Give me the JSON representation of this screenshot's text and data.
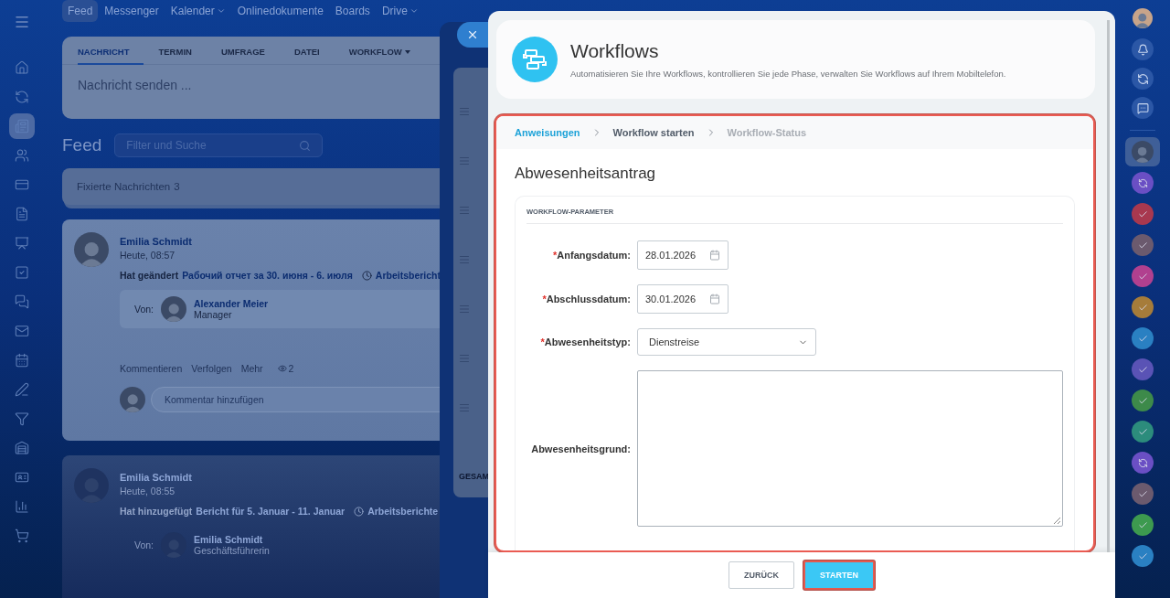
{
  "sidebar": {
    "items": [
      {
        "selected": false
      },
      {
        "selected": false
      },
      {
        "selected": true
      },
      {
        "selected": false
      },
      {
        "selected": false
      },
      {
        "selected": false
      },
      {
        "selected": false
      },
      {
        "selected": false
      },
      {
        "selected": false
      },
      {
        "selected": false
      },
      {
        "selected": false
      },
      {
        "selected": false
      },
      {
        "selected": false
      },
      {
        "selected": false
      },
      {
        "selected": false
      },
      {
        "selected": false
      },
      {
        "selected": false
      }
    ]
  },
  "top_nav": [
    {
      "label": "Feed",
      "selected": true,
      "has_menu": false
    },
    {
      "label": "Messenger",
      "selected": false,
      "has_menu": false
    },
    {
      "label": "Kalender",
      "selected": false,
      "has_menu": true
    },
    {
      "label": "Onlinedokumente",
      "selected": false,
      "has_menu": false
    },
    {
      "label": "Boards",
      "selected": false,
      "has_menu": false
    },
    {
      "label": "Drive",
      "selected": false,
      "has_menu": true
    }
  ],
  "composer": {
    "tabs": [
      {
        "label": "NACHRICHT",
        "selected": true,
        "has_menu": false
      },
      {
        "label": "TERMIN",
        "selected": false,
        "has_menu": false
      },
      {
        "label": "UMFRAGE",
        "selected": false,
        "has_menu": false
      },
      {
        "label": "DATEI",
        "selected": false,
        "has_menu": false
      },
      {
        "label": "WORKFLOW",
        "selected": false,
        "has_menu": true
      }
    ],
    "placeholder": "Nachricht senden ..."
  },
  "feed": {
    "title": "Feed",
    "search_placeholder": "Filter und Suche",
    "pinned": "Fixierte Nachrichten",
    "pinned_count": "3",
    "posts": [
      {
        "author": "Emilia Schmidt",
        "time": "Heute, 08:57",
        "action": "Hat geändert",
        "link": "Рабочий отчет за 30. июня - 6. июля",
        "category": "Arbeitsbericht",
        "from_label": "Von:",
        "from_name": "Alexander Meier",
        "from_role": "Manager",
        "actions": [
          "Kommentieren",
          "Verfolgen",
          "Mehr"
        ],
        "views": "2",
        "comment_placeholder": "Kommentar hinzufügen",
        "faded": false
      },
      {
        "author": "Emilia Schmidt",
        "time": "Heute, 08:55",
        "action": "Hat hinzugefügt",
        "link": "Bericht für 5. Januar - 11. Januar",
        "category": "Arbeitsberichte",
        "from_label": "Von:",
        "from_name": "Emilia Schmidt",
        "from_role": "Geschäftsführerin",
        "faded": true
      }
    ]
  },
  "back_panel": {
    "footer": "GESAM"
  },
  "panel": {
    "title": "Workflows",
    "subtitle": "Automatisieren Sie Ihre Workflows, kontrollieren Sie jede Phase, verwalten Sie Workflows auf Ihrem Mobiltelefon.",
    "steps": [
      {
        "label": "Anweisungen",
        "completed": true,
        "selected": false
      },
      {
        "label": "Workflow starten",
        "completed": false,
        "selected": true
      },
      {
        "label": "Workflow-Status",
        "completed": false,
        "selected": false
      }
    ],
    "form_title": "Abwesenheitsantrag",
    "section": "WORKFLOW-PARAMETER",
    "fields": [
      {
        "kind": "date",
        "mark": "*",
        "label": "Anfangsdatum:",
        "value": "28.01.2026"
      },
      {
        "kind": "date",
        "mark": "*",
        "label": "Abschlussdatum:",
        "value": "30.01.2026"
      },
      {
        "kind": "select",
        "mark": "*",
        "label": "Abwesenheitstyp:",
        "value": "Dienstreise"
      },
      {
        "kind": "textarea",
        "label": "Abwesenheitsgrund:"
      }
    ],
    "buttons": [
      {
        "label": "ZURÜCK",
        "primary": false
      },
      {
        "label": "STARTEN",
        "primary": true
      }
    ]
  },
  "right_rail": [
    {
      "kind": "avatar",
      "selected": true
    },
    {
      "kind": "ring",
      "color": "#6a4fc4"
    },
    {
      "kind": "task",
      "color": "#a8384f"
    },
    {
      "kind": "task",
      "color": "#6b5a6e"
    },
    {
      "kind": "task",
      "color": "#b1408f"
    },
    {
      "kind": "task",
      "color": "#a67c3a"
    },
    {
      "kind": "task",
      "color": "#2a80c2"
    },
    {
      "kind": "task",
      "color": "#5a53b5"
    },
    {
      "kind": "task",
      "color": "#3d8a4a"
    },
    {
      "kind": "task",
      "color": "#2c8c7c"
    },
    {
      "kind": "ring",
      "color": "#6a4fc4"
    },
    {
      "kind": "task",
      "color": "#6b5a6e"
    },
    {
      "kind": "task",
      "color": "#3d9a4f"
    },
    {
      "kind": "task",
      "color": "#2a80c2"
    }
  ]
}
